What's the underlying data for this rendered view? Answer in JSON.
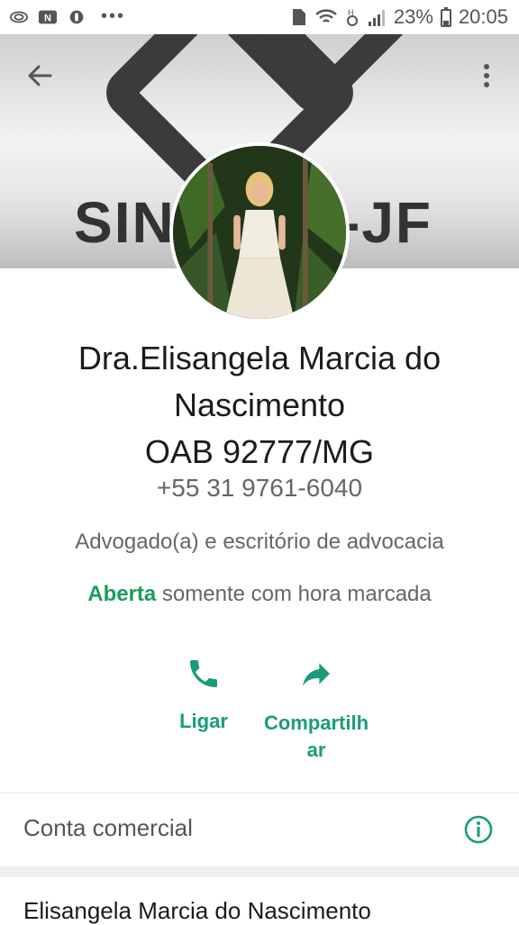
{
  "status_bar": {
    "battery": "23%",
    "time": "20:05",
    "more": "•••"
  },
  "cover": {
    "text_left": "SIN",
    "text_right": "-JF"
  },
  "profile": {
    "name_line1": "Dra.Elisangela Marcia do",
    "name_line2": "Nascimento",
    "name_line3": "OAB 92777/MG",
    "phone": "+55 31 9761-6040",
    "category": "Advogado(a) e escritório de advocacia",
    "hours_status": "Aberta",
    "hours_detail": " somente com hora marcada"
  },
  "actions": {
    "call": "Ligar",
    "share": "Compartilh ar"
  },
  "account": {
    "label": "Conta comercial",
    "business_name": "Elisangela Marcia do Nascimento"
  },
  "colors": {
    "accent": "#1a9c7a",
    "open": "#1a9c5c",
    "text_primary": "#1b1b1b",
    "text_secondary": "#666666"
  }
}
